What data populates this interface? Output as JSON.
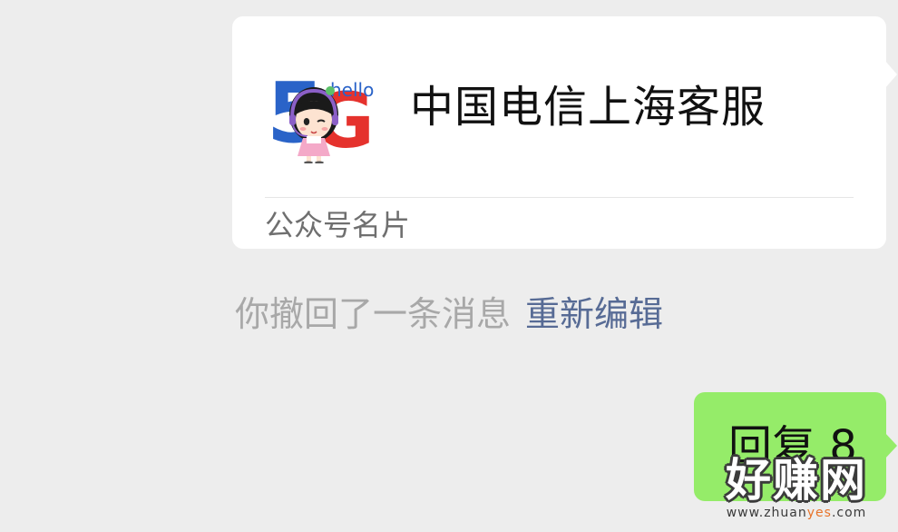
{
  "card": {
    "name": "中国电信上海客服",
    "type_label": "公众号名片",
    "avatar": {
      "logo_text": "5G",
      "badge_text": "hello",
      "colors": {
        "five": "#2a63c8",
        "g": "#e5322d",
        "hair": "#1a1a1a",
        "skin": "#fde3d1",
        "dress": "#f4a9c8",
        "headset": "#8b5fc7"
      }
    }
  },
  "notice": {
    "text": "你撤回了一条消息",
    "action_label": "重新编辑"
  },
  "outgoing": {
    "text": "回复 8"
  },
  "watermark": {
    "main": "好赚网",
    "url_prefix": "www.zhuan",
    "url_highlight": "yes",
    "url_suffix": ".com"
  },
  "colors": {
    "background": "#ededed",
    "card_bg": "#ffffff",
    "bubble_green": "#95ec69",
    "link_blue": "#576b95",
    "notice_gray": "#a8a8a8"
  }
}
